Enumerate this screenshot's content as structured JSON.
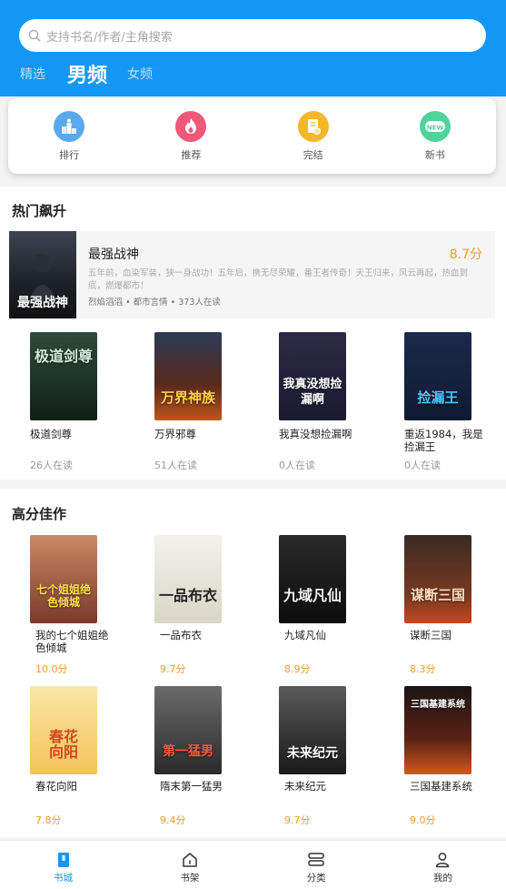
{
  "search": {
    "placeholder": "支持书名/作者/主角搜索"
  },
  "tabs": [
    {
      "label": "精选",
      "active": false
    },
    {
      "label": "男频",
      "active": true
    },
    {
      "label": "女频",
      "active": false
    }
  ],
  "quick_links": [
    {
      "label": "排行",
      "icon": "ranking-icon",
      "color": "#5aa9ee"
    },
    {
      "label": "推荐",
      "icon": "flame-icon",
      "color": "#f0587a"
    },
    {
      "label": "完结",
      "icon": "completed-icon",
      "color": "#f5b72a"
    },
    {
      "label": "新书",
      "icon": "new-icon",
      "color": "#4fd39a"
    }
  ],
  "hot": {
    "title": "热门飙升",
    "featured": {
      "title": "最强战神",
      "score": "8.7分",
      "desc": "五年前，血染军装，狭一身战功！五年后，携无尽荣耀，番王者传奇！天王归来，风云再起，热血到底，燃爆都市！",
      "meta": "烈焰滔滔 • 都市言情 • 373人在读",
      "cover_text": "最强战神"
    },
    "books": [
      {
        "title": "极道剑尊",
        "reading": "26人在读",
        "cover_text": "极道剑尊"
      },
      {
        "title": "万界邪尊",
        "reading": "51人在读",
        "cover_text": "万界神族"
      },
      {
        "title": "我真没想捡漏啊",
        "reading": "0人在读",
        "cover_text": "我真没想捡漏啊"
      },
      {
        "title": "重返1984，我是捡漏王",
        "reading": "0人在读",
        "cover_text": "捡漏王"
      }
    ]
  },
  "high_score": {
    "title": "高分佳作",
    "books": [
      {
        "title": "我的七个姐姐绝色倾城",
        "score": "10.0分",
        "cover_text": "七个姐姐绝色倾城"
      },
      {
        "title": "一品布衣",
        "score": "9.7分",
        "cover_text": "一品布衣"
      },
      {
        "title": "九域凡仙",
        "score": "8.9分",
        "cover_text": "九域凡仙"
      },
      {
        "title": "谋断三国",
        "score": "8.3分",
        "cover_text": "谋断三国"
      },
      {
        "title": "春花向阳",
        "score": "7.8分",
        "cover_text": "春花向阳"
      },
      {
        "title": "隋末第一猛男",
        "score": "9.4分",
        "cover_text": "第一猛男"
      },
      {
        "title": "未来纪元",
        "score": "9.7分",
        "cover_text": "未来纪元"
      },
      {
        "title": "三国基建系统",
        "score": "9.0分",
        "cover_text": "三国基建系统"
      }
    ]
  },
  "navbar": [
    {
      "label": "书城",
      "active": true
    },
    {
      "label": "书架",
      "active": false
    },
    {
      "label": "分类",
      "active": false
    },
    {
      "label": "我的",
      "active": false
    }
  ],
  "colors": {
    "brand": "#1298f4",
    "score": "#f29a2e"
  }
}
